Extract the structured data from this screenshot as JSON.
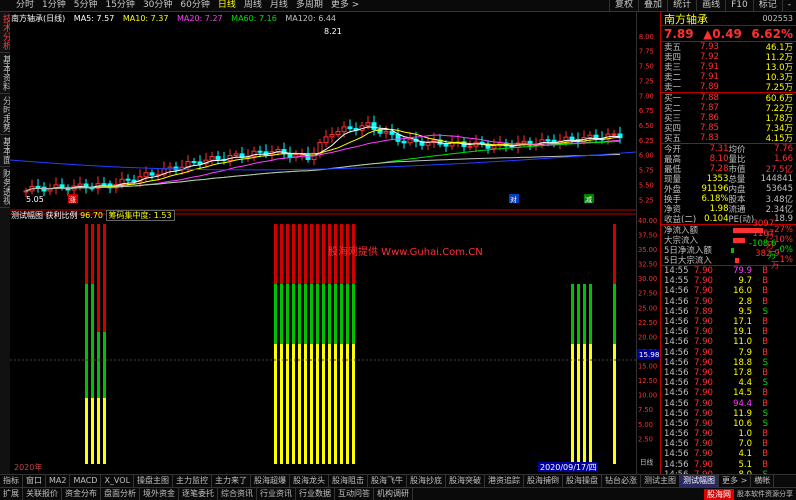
{
  "top_tabs": [
    "分时",
    "1分钟",
    "5分钟",
    "15分钟",
    "30分钟",
    "60分钟",
    "日线",
    "周线",
    "月线",
    "多周期",
    "更多 >"
  ],
  "top_tabs_active": 6,
  "top_right_tabs": [
    "复权",
    "叠加",
    "统计",
    "画线",
    "F10",
    "标记",
    "-"
  ],
  "left_vertical_tabs": [
    "技术分析",
    "基本资料",
    "分时走势",
    "基本面",
    "财务透视"
  ],
  "left_vertical_active": 0,
  "legend1": {
    "stock": "南方轴承(日线)",
    "ma5": "MA5: 7.57",
    "ma10": "MA10: 7.37",
    "ma20": "MA20: 7.27",
    "ma60": "MA60: 7.16",
    "ma120": "MA120: 6.44",
    "high_mark": "8.21",
    "low_mark": "5.05"
  },
  "legend2": {
    "name": "测试幅图",
    "k1": "获利比例",
    "v1": "96.70",
    "k2": "筹码集中度",
    "v2": "1.53"
  },
  "watermark": "股海网提供 Www.Guhai.Com.CN",
  "upper_axis": [
    "8.00",
    "7.75",
    "7.50",
    "7.25",
    "7.00",
    "6.75",
    "6.50",
    "6.25",
    "6.00",
    "5.75",
    "5.50",
    "5.25"
  ],
  "lower_axis": [
    "40.00",
    "37.50",
    "35.00",
    "32.50",
    "30.00",
    "27.50",
    "25.00",
    "22.50",
    "20.00",
    "17.50",
    "15.00",
    "12.50",
    "10.00",
    "7.50",
    "5.00",
    "2.50"
  ],
  "cursor_value": "15.98",
  "bottom_date_left": "2020年",
  "bottom_date_cursor": "2020/09/17/四",
  "small_labels": {
    "zhang": "涨",
    "dui": "对",
    "jian": "减",
    "rixian": "日线"
  },
  "side": {
    "name": "南方轴承",
    "code": "002553",
    "price": "7.89",
    "change": "▲0.49",
    "pct": "6.62%",
    "sells": [
      {
        "label": "卖五",
        "price": "7.93",
        "vol": "46.1万"
      },
      {
        "label": "卖四",
        "price": "7.92",
        "vol": "11.2万"
      },
      {
        "label": "卖三",
        "price": "7.91",
        "vol": "13.0万"
      },
      {
        "label": "卖二",
        "price": "7.91",
        "vol": "10.3万"
      },
      {
        "label": "卖一",
        "price": "7.89",
        "vol": "7.25万"
      }
    ],
    "buys": [
      {
        "label": "买一",
        "price": "7.88",
        "vol": "60.6万"
      },
      {
        "label": "买二",
        "price": "7.87",
        "vol": "7.22万"
      },
      {
        "label": "买三",
        "price": "7.86",
        "vol": "1.78万"
      },
      {
        "label": "买四",
        "price": "7.85",
        "vol": "7.34万"
      },
      {
        "label": "买五",
        "price": "7.83",
        "vol": "4.15万"
      }
    ],
    "info": [
      {
        "k": "今开",
        "v": "7.31",
        "k2": "均价",
        "v2": "7.76"
      },
      {
        "k": "最高",
        "v": "8.10",
        "k2": "量比",
        "v2": "1.66"
      },
      {
        "k": "最低",
        "v": "7.28",
        "k2": "市值",
        "v2": "27.5亿"
      },
      {
        "k": "现量",
        "v": "1353",
        "k2": "总量",
        "v2": "144841"
      },
      {
        "k": "外盘",
        "v": "91196",
        "k2": "内盘",
        "v2": "53645"
      },
      {
        "k": "换手",
        "v": "6.18%",
        "k2": "股本",
        "v2": "3.48亿"
      },
      {
        "k": "净资",
        "v": "1.98",
        "k2": "流通",
        "v2": "2.34亿"
      },
      {
        "k": "收益(二)",
        "v": "0.104",
        "k2": "PE(动)",
        "v2": "18.9"
      }
    ],
    "flows": [
      {
        "k": "净流入额",
        "v": "3097万",
        "pct": "27%",
        "neg": false,
        "bar": 30
      },
      {
        "k": "大宗流入",
        "v": "1167万",
        "pct": "10%",
        "neg": false,
        "bar": 12
      },
      {
        "k": "5日净流入额",
        "v": "-108.6万",
        "pct": "-0%",
        "neg": true,
        "bar": 3
      },
      {
        "k": "5日大宗流入",
        "v": "382.9万",
        "pct": "1%",
        "neg": false,
        "bar": 4
      }
    ],
    "ticks": [
      {
        "t": "14:55",
        "p": "7.90",
        "q": "79.9",
        "s": "B",
        "m": true
      },
      {
        "t": "14:55",
        "p": "7.90",
        "q": "9.7",
        "s": "B"
      },
      {
        "t": "14:56",
        "p": "7.90",
        "q": "16.0",
        "s": "B"
      },
      {
        "t": "14:56",
        "p": "7.90",
        "q": "2.8",
        "s": "B"
      },
      {
        "t": "14:56",
        "p": "7.89",
        "q": "9.5",
        "s": "S"
      },
      {
        "t": "14:56",
        "p": "7.90",
        "q": "17.1",
        "s": "B"
      },
      {
        "t": "14:56",
        "p": "7.90",
        "q": "19.1",
        "s": "B"
      },
      {
        "t": "14:56",
        "p": "7.90",
        "q": "11.0",
        "s": "B"
      },
      {
        "t": "14:56",
        "p": "7.90",
        "q": "7.9",
        "s": "B"
      },
      {
        "t": "14:56",
        "p": "7.90",
        "q": "18.8",
        "s": "S"
      },
      {
        "t": "14:56",
        "p": "7.90",
        "q": "17.8",
        "s": "B"
      },
      {
        "t": "14:56",
        "p": "7.90",
        "q": "4.4",
        "s": "S"
      },
      {
        "t": "14:56",
        "p": "7.90",
        "q": "14.5",
        "s": "B"
      },
      {
        "t": "14:56",
        "p": "7.90",
        "q": "94.4",
        "s": "B",
        "m": true
      },
      {
        "t": "14:56",
        "p": "7.90",
        "q": "11.9",
        "s": "S"
      },
      {
        "t": "14:56",
        "p": "7.90",
        "q": "10.6",
        "s": "S"
      },
      {
        "t": "14:56",
        "p": "7.90",
        "q": "1.0",
        "s": "B"
      },
      {
        "t": "14:56",
        "p": "7.90",
        "q": "7.0",
        "s": "B"
      },
      {
        "t": "14:56",
        "p": "7.90",
        "q": "4.1",
        "s": "B"
      },
      {
        "t": "14:56",
        "p": "7.90",
        "q": "5.1",
        "s": "B"
      },
      {
        "t": "14:56",
        "p": "7.90",
        "q": "8.0",
        "s": "S"
      }
    ]
  },
  "bottom_row1": [
    "指标",
    "窗口",
    "MA2",
    "MACD",
    "X_VOL",
    "操盘主图",
    "主力监控",
    "主力来了",
    "股海超爆",
    "股海龙头",
    "股海阻击",
    "股海飞牛",
    "股海抄底",
    "股海突破",
    "港资追踪",
    "股海捕倒",
    "股海操盘",
    "钻台必涨",
    "测试主图",
    "测试幅图",
    "更多 >",
    "横帐"
  ],
  "bottom_row1_active": 19,
  "bottom_row2": [
    "扩展",
    "关联报价",
    "资金分布",
    "盘面分析",
    "境外资金",
    "逐笔委托",
    "综合资讯",
    "行业资讯",
    "行业数据",
    "互动问答",
    "机构调研"
  ],
  "brand": {
    "logo": "股海网",
    "slogan": "股本软件资源分享"
  },
  "colors": {
    "up": "#ff3030",
    "down": "#00e000",
    "bar_red": "#d00000",
    "bar_green": "#00c000",
    "bar_yellow": "#ffff00"
  },
  "chart_data": {
    "type": "bar",
    "ylim": [
      0,
      40
    ],
    "bar_groups": [
      {
        "x": [
          85,
          91,
          97,
          103
        ],
        "red": [
          40,
          40,
          40,
          40
        ],
        "green": [
          30,
          30,
          22,
          22
        ],
        "yellow": [
          11,
          11,
          11,
          11
        ]
      },
      {
        "x": [
          274,
          280,
          286,
          292,
          298,
          304,
          310,
          316,
          322,
          328,
          334,
          340,
          346,
          352
        ],
        "red": [
          40,
          40,
          40,
          40,
          40,
          40,
          40,
          40,
          40,
          40,
          40,
          40,
          40,
          40
        ],
        "green": [
          30,
          30,
          30,
          30,
          30,
          30,
          30,
          30,
          30,
          30,
          30,
          30,
          30,
          30
        ],
        "yellow": [
          20,
          20,
          20,
          20,
          20,
          20,
          20,
          20,
          20,
          20,
          20,
          20,
          20,
          20
        ]
      },
      {
        "x": [
          571,
          577,
          583,
          589
        ],
        "red": [
          30,
          30,
          30,
          30
        ],
        "green": [
          30,
          30,
          30,
          30
        ],
        "yellow": [
          20,
          20,
          20,
          20
        ]
      },
      {
        "x": [
          613
        ],
        "red": [
          40
        ],
        "green": [
          30
        ],
        "yellow": [
          20
        ]
      }
    ]
  }
}
